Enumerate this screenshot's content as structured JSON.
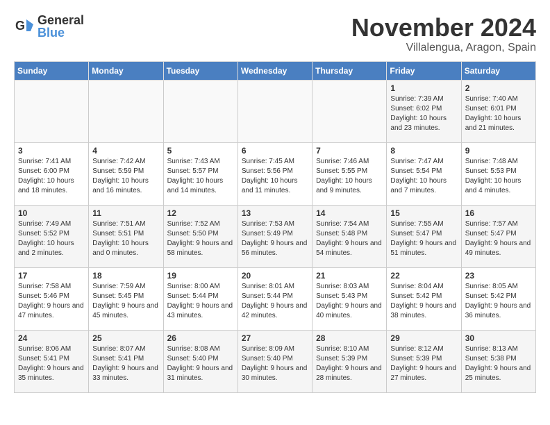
{
  "logo": {
    "general": "General",
    "blue": "Blue"
  },
  "title": {
    "month": "November 2024",
    "location": "Villalengua, Aragon, Spain"
  },
  "days_of_week": [
    "Sunday",
    "Monday",
    "Tuesday",
    "Wednesday",
    "Thursday",
    "Friday",
    "Saturday"
  ],
  "weeks": [
    [
      {
        "day": "",
        "info": ""
      },
      {
        "day": "",
        "info": ""
      },
      {
        "day": "",
        "info": ""
      },
      {
        "day": "",
        "info": ""
      },
      {
        "day": "",
        "info": ""
      },
      {
        "day": "1",
        "info": "Sunrise: 7:39 AM\nSunset: 6:02 PM\nDaylight: 10 hours and 23 minutes."
      },
      {
        "day": "2",
        "info": "Sunrise: 7:40 AM\nSunset: 6:01 PM\nDaylight: 10 hours and 21 minutes."
      }
    ],
    [
      {
        "day": "3",
        "info": "Sunrise: 7:41 AM\nSunset: 6:00 PM\nDaylight: 10 hours and 18 minutes."
      },
      {
        "day": "4",
        "info": "Sunrise: 7:42 AM\nSunset: 5:59 PM\nDaylight: 10 hours and 16 minutes."
      },
      {
        "day": "5",
        "info": "Sunrise: 7:43 AM\nSunset: 5:57 PM\nDaylight: 10 hours and 14 minutes."
      },
      {
        "day": "6",
        "info": "Sunrise: 7:45 AM\nSunset: 5:56 PM\nDaylight: 10 hours and 11 minutes."
      },
      {
        "day": "7",
        "info": "Sunrise: 7:46 AM\nSunset: 5:55 PM\nDaylight: 10 hours and 9 minutes."
      },
      {
        "day": "8",
        "info": "Sunrise: 7:47 AM\nSunset: 5:54 PM\nDaylight: 10 hours and 7 minutes."
      },
      {
        "day": "9",
        "info": "Sunrise: 7:48 AM\nSunset: 5:53 PM\nDaylight: 10 hours and 4 minutes."
      }
    ],
    [
      {
        "day": "10",
        "info": "Sunrise: 7:49 AM\nSunset: 5:52 PM\nDaylight: 10 hours and 2 minutes."
      },
      {
        "day": "11",
        "info": "Sunrise: 7:51 AM\nSunset: 5:51 PM\nDaylight: 10 hours and 0 minutes."
      },
      {
        "day": "12",
        "info": "Sunrise: 7:52 AM\nSunset: 5:50 PM\nDaylight: 9 hours and 58 minutes."
      },
      {
        "day": "13",
        "info": "Sunrise: 7:53 AM\nSunset: 5:49 PM\nDaylight: 9 hours and 56 minutes."
      },
      {
        "day": "14",
        "info": "Sunrise: 7:54 AM\nSunset: 5:48 PM\nDaylight: 9 hours and 54 minutes."
      },
      {
        "day": "15",
        "info": "Sunrise: 7:55 AM\nSunset: 5:47 PM\nDaylight: 9 hours and 51 minutes."
      },
      {
        "day": "16",
        "info": "Sunrise: 7:57 AM\nSunset: 5:47 PM\nDaylight: 9 hours and 49 minutes."
      }
    ],
    [
      {
        "day": "17",
        "info": "Sunrise: 7:58 AM\nSunset: 5:46 PM\nDaylight: 9 hours and 47 minutes."
      },
      {
        "day": "18",
        "info": "Sunrise: 7:59 AM\nSunset: 5:45 PM\nDaylight: 9 hours and 45 minutes."
      },
      {
        "day": "19",
        "info": "Sunrise: 8:00 AM\nSunset: 5:44 PM\nDaylight: 9 hours and 43 minutes."
      },
      {
        "day": "20",
        "info": "Sunrise: 8:01 AM\nSunset: 5:44 PM\nDaylight: 9 hours and 42 minutes."
      },
      {
        "day": "21",
        "info": "Sunrise: 8:03 AM\nSunset: 5:43 PM\nDaylight: 9 hours and 40 minutes."
      },
      {
        "day": "22",
        "info": "Sunrise: 8:04 AM\nSunset: 5:42 PM\nDaylight: 9 hours and 38 minutes."
      },
      {
        "day": "23",
        "info": "Sunrise: 8:05 AM\nSunset: 5:42 PM\nDaylight: 9 hours and 36 minutes."
      }
    ],
    [
      {
        "day": "24",
        "info": "Sunrise: 8:06 AM\nSunset: 5:41 PM\nDaylight: 9 hours and 35 minutes."
      },
      {
        "day": "25",
        "info": "Sunrise: 8:07 AM\nSunset: 5:41 PM\nDaylight: 9 hours and 33 minutes."
      },
      {
        "day": "26",
        "info": "Sunrise: 8:08 AM\nSunset: 5:40 PM\nDaylight: 9 hours and 31 minutes."
      },
      {
        "day": "27",
        "info": "Sunrise: 8:09 AM\nSunset: 5:40 PM\nDaylight: 9 hours and 30 minutes."
      },
      {
        "day": "28",
        "info": "Sunrise: 8:10 AM\nSunset: 5:39 PM\nDaylight: 9 hours and 28 minutes."
      },
      {
        "day": "29",
        "info": "Sunrise: 8:12 AM\nSunset: 5:39 PM\nDaylight: 9 hours and 27 minutes."
      },
      {
        "day": "30",
        "info": "Sunrise: 8:13 AM\nSunset: 5:38 PM\nDaylight: 9 hours and 25 minutes."
      }
    ]
  ]
}
